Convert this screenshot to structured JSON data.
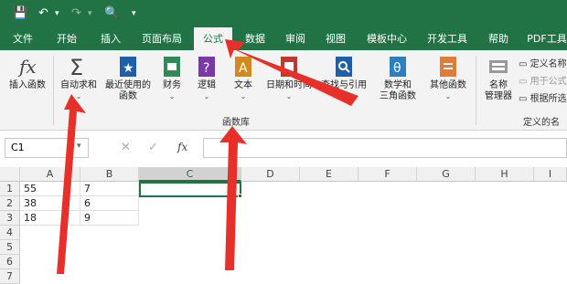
{
  "quick_access": [
    "💾",
    "↶",
    "▾",
    "↷",
    "▾",
    "🔍",
    "▾"
  ],
  "tabs": [
    "文件",
    "开始",
    "插入",
    "页面布局",
    "公式",
    "数据",
    "审阅",
    "视图",
    "模板中心",
    "开发工具",
    "帮助",
    "PDF工具"
  ],
  "active_tab": "公式",
  "ribbon": {
    "insert_function": "插入函数",
    "autosum": "自动求和",
    "recent": [
      "最近使用的",
      "函数"
    ],
    "finance": "财务",
    "logical": "逻辑",
    "text": "文本",
    "datetime": "日期和时间",
    "lookup": "查找与引用",
    "math": [
      "数学和",
      "三角函数"
    ],
    "more": "其他函数",
    "group_label": "函数库",
    "name_manager": [
      "名称",
      "管理器"
    ],
    "define_name": "定义名称",
    "use_in_formula": "用于公式",
    "create_from_selection": "根据所选",
    "defined_names_group": "定义的名称"
  },
  "formula_bar": {
    "name_box": "C1",
    "cancel": "✕",
    "confirm": "✓",
    "fx": "fx",
    "formula": ""
  },
  "columns": [
    "A",
    "B",
    "C",
    "D",
    "E",
    "F",
    "G",
    "H",
    "I"
  ],
  "rows": [
    "1",
    "2",
    "3",
    "4",
    "5",
    "6",
    "7"
  ],
  "cells": [
    [
      "55",
      "7"
    ],
    [
      "38",
      "6"
    ],
    [
      "18",
      "9"
    ]
  ],
  "colors": {
    "brand": "#217346",
    "arrow": "#e8302a"
  }
}
